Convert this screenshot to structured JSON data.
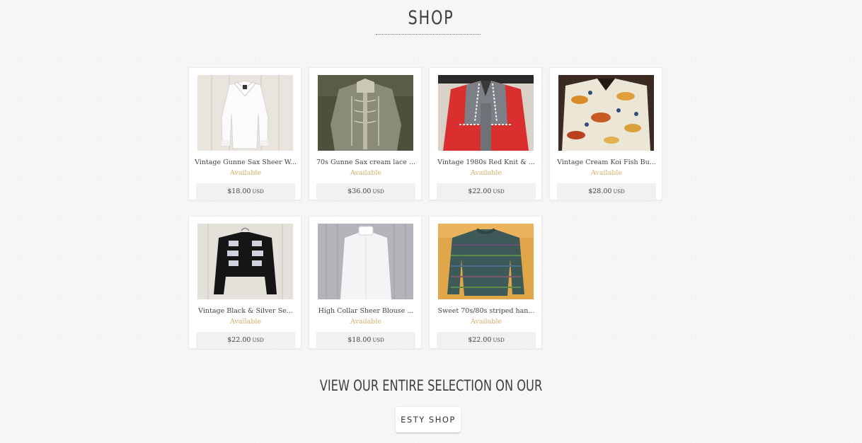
{
  "page": {
    "title": "SHOP",
    "cta_text": "VIEW OUR ENTIRE SELECTION ON OUR",
    "cta_button": "ESTY SHOP"
  },
  "colors": {
    "background": "#f6f6f4",
    "card": "#ffffff",
    "available": "#d1b068",
    "price_bar": "#f1f1f1",
    "heading": "#3f3f3f"
  },
  "products": [
    {
      "title": "Vintage Gunne Sax Sheer W...",
      "status": "Available",
      "price": "$18.00",
      "currency": "USD",
      "image": "white-sheer-blouse-photo"
    },
    {
      "title": "70s Gunne Sax cream lace ...",
      "status": "Available",
      "price": "$36.00",
      "currency": "USD",
      "image": "cream-lace-blouse-photo"
    },
    {
      "title": "Vintage 1980s Red Knit & ...",
      "status": "Available",
      "price": "$22.00",
      "currency": "USD",
      "image": "red-grey-knit-jacket-photo"
    },
    {
      "title": "Vintage Cream Koi Fish Bu...",
      "status": "Available",
      "price": "$28.00",
      "currency": "USD",
      "image": "koi-fish-print-shirt-photo"
    },
    {
      "title": "Vintage Black & Silver Se...",
      "status": "Available",
      "price": "$22.00",
      "currency": "USD",
      "image": "black-silver-sequin-jacket-photo"
    },
    {
      "title": "High Collar Sheer Blouse ...",
      "status": "Available",
      "price": "$18.00",
      "currency": "USD",
      "image": "white-high-collar-blouse-photo"
    },
    {
      "title": "Sweet 70s/80s striped han...",
      "status": "Available",
      "price": "$22.00",
      "currency": "USD",
      "image": "striped-knit-sweater-photo"
    }
  ]
}
